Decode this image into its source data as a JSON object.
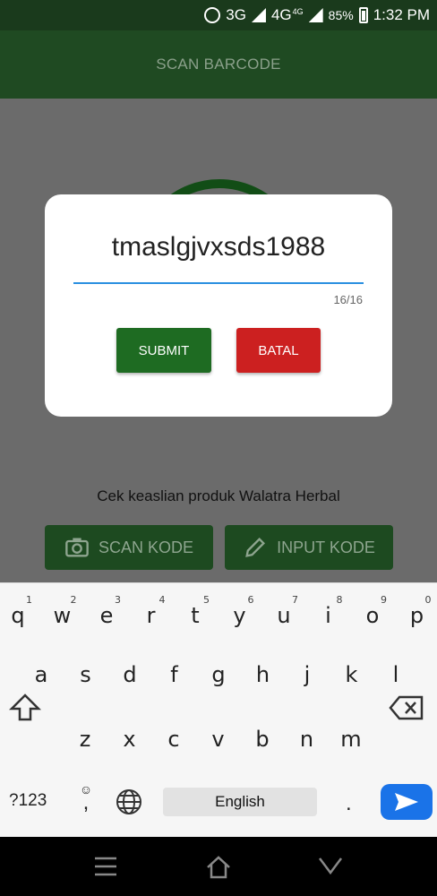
{
  "status_bar": {
    "network_1": "3G",
    "network_2": "4G",
    "network_2_sup": "4G",
    "battery": "85%",
    "time": "1:32 PM"
  },
  "app_bar": {
    "title": "SCAN BARCODE"
  },
  "main": {
    "subtitle": "Cek keaslian produk Walatra Herbal",
    "scan_button": "SCAN KODE",
    "input_button": "INPUT KODE"
  },
  "dialog": {
    "input_value": "tmaslgjvxsds1988",
    "counter": "16/16",
    "submit_label": "SUBMIT",
    "cancel_label": "BATAL"
  },
  "keyboard": {
    "row1": [
      "q",
      "w",
      "e",
      "r",
      "t",
      "y",
      "u",
      "i",
      "o",
      "p"
    ],
    "row1_hints": [
      "1",
      "2",
      "3",
      "4",
      "5",
      "6",
      "7",
      "8",
      "9",
      "0"
    ],
    "row2": [
      "a",
      "s",
      "d",
      "f",
      "g",
      "h",
      "j",
      "k",
      "l"
    ],
    "row3": [
      "z",
      "x",
      "c",
      "v",
      "b",
      "n",
      "m"
    ],
    "symbols_key": "?123",
    "comma_key": ",",
    "space_label": "English",
    "period_key": "."
  },
  "colors": {
    "accent_green": "#1e6b22",
    "cancel_red": "#cc2020",
    "underline_blue": "#2a8fe0",
    "send_blue": "#1a73e8"
  }
}
